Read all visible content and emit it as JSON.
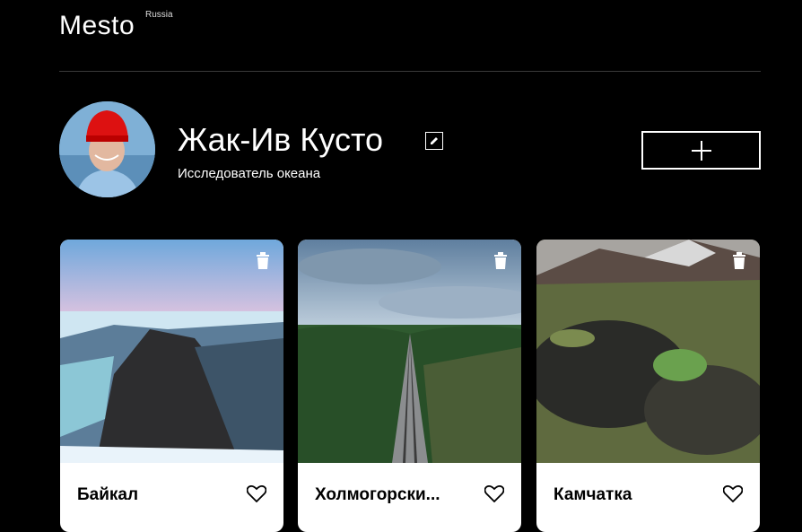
{
  "header": {
    "logo": "Mesto",
    "logo_sup": "Russia"
  },
  "profile": {
    "name": "Жак-Ив Кусто",
    "about": "Исследователь океана"
  },
  "icons": {
    "edit": "pencil-icon",
    "add": "plus-icon",
    "delete": "trash-icon",
    "like": "heart-icon"
  },
  "cards": [
    {
      "title": "Байкал"
    },
    {
      "title": "Холмогорски..."
    },
    {
      "title": "Камчатка"
    }
  ]
}
